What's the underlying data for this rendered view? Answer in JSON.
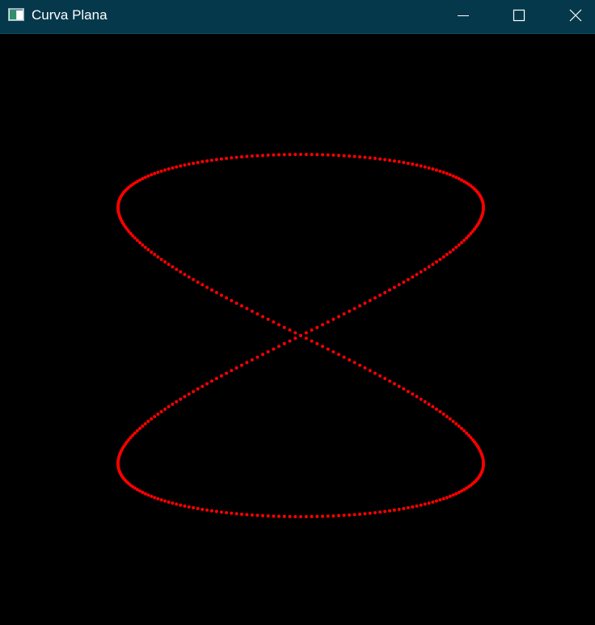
{
  "window": {
    "title": "Curva Plana",
    "app_icon": "window-app-icon",
    "controls": {
      "minimize_icon": "minimize-icon",
      "maximize_icon": "maximize-icon",
      "close_icon": "close-icon"
    },
    "colors": {
      "titlebar": "#04384a",
      "background": "#000000",
      "curve": "#ff0000",
      "title_text": "#ffffff"
    }
  },
  "plot": {
    "curve_type": "lissajous-figure-eight",
    "point_count": 420,
    "point_color": "#ff0000"
  }
}
